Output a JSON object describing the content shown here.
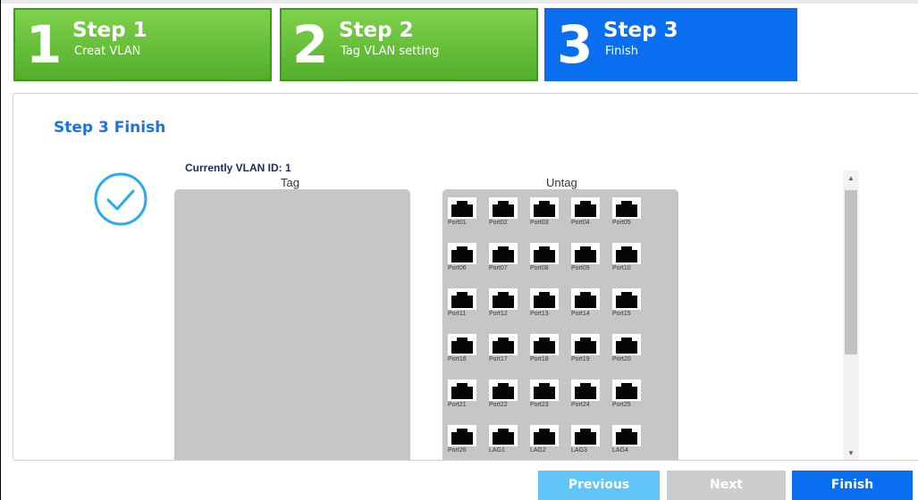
{
  "steps": [
    {
      "number": "1",
      "title": "Step 1",
      "subtitle": "Creat VLAN",
      "state": "done"
    },
    {
      "number": "2",
      "title": "Step 2",
      "subtitle": "Tag VLAN setting",
      "state": "done"
    },
    {
      "number": "3",
      "title": "Step 3",
      "subtitle": "Finish",
      "state": "active"
    }
  ],
  "panel": {
    "title": "Step 3 Finish",
    "vlan_id_text": "Currently VLAN ID: 1",
    "tag_label": "Tag",
    "untag_label": "Untag",
    "untag_ports": [
      "Port01",
      "Port02",
      "Port03",
      "Port04",
      "Port05",
      "Port06",
      "Port07",
      "Port08",
      "Port09",
      "Port10",
      "Port11",
      "Port12",
      "Port13",
      "Port14",
      "Port15",
      "Port16",
      "Port17",
      "Port18",
      "Port19",
      "Port20",
      "Port21",
      "Port22",
      "Port23",
      "Port24",
      "Port25",
      "Port26",
      "LAG1",
      "LAG2",
      "LAG3",
      "LAG4"
    ],
    "tag_ports": []
  },
  "buttons": {
    "previous": "Previous",
    "next": "Next",
    "finish": "Finish"
  },
  "icons": {
    "success": "check-circle-icon",
    "port": "ethernet-port-icon",
    "scroll_up": "scroll-up-arrow-icon",
    "scroll_down": "scroll-down-arrow-icon"
  },
  "colors": {
    "step_done": "#52ae2a",
    "step_active": "#0a6ef0",
    "title_blue": "#1a73e8",
    "check": "#29aaf0",
    "btn_previous": "#61c5f7",
    "btn_next_disabled": "#cdcdcd",
    "btn_finish": "#0a6ef0"
  }
}
